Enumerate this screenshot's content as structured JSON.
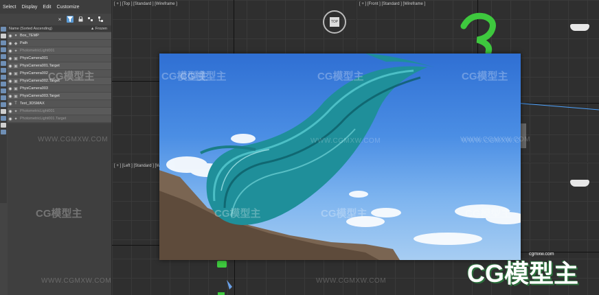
{
  "menu": [
    "Select",
    "Display",
    "Edit",
    "Customize"
  ],
  "toolbar": {
    "close_icon": "×",
    "filter_icon": "funnel-icon"
  },
  "explorer": {
    "column_name": "Name (Sorted Ascending)",
    "column_frozen": "▲ Frozen",
    "rows": [
      {
        "name": "Box_TEMP",
        "dim": false
      },
      {
        "name": "Path",
        "dim": false
      },
      {
        "name": "PhotometricLight001",
        "dim": true
      },
      {
        "name": "PhysCamera001",
        "dim": false
      },
      {
        "name": "PhysCamera001.Target",
        "dim": false
      },
      {
        "name": "PhysCamera002",
        "dim": false
      },
      {
        "name": "PhysCamera002.Target",
        "dim": false
      },
      {
        "name": "PhysCamera003",
        "dim": false
      },
      {
        "name": "PhysCamera003.Target",
        "dim": false
      },
      {
        "name": "Text_3DSMAX",
        "dim": false
      },
      {
        "name": "PhotometricLight001",
        "dim": true
      },
      {
        "name": "PhotometricLight001.Target",
        "dim": true
      }
    ]
  },
  "viewports": {
    "top": "[ + ] [Top ] [Standard ] [Wireframe ]",
    "front": "[ + ] [Front ] [Standard ] [Wireframe ]",
    "left": "[ + ] [Left ] [Standard ] [Wireframe ]"
  },
  "watermark": {
    "brand": "CG模型主",
    "url": "WWW.CGMXW.COM",
    "url_small": "cgmxw.com"
  },
  "colors": {
    "accent": "#5b9bd5",
    "hair": "#2aa7b0",
    "green": "#3ec83e"
  }
}
